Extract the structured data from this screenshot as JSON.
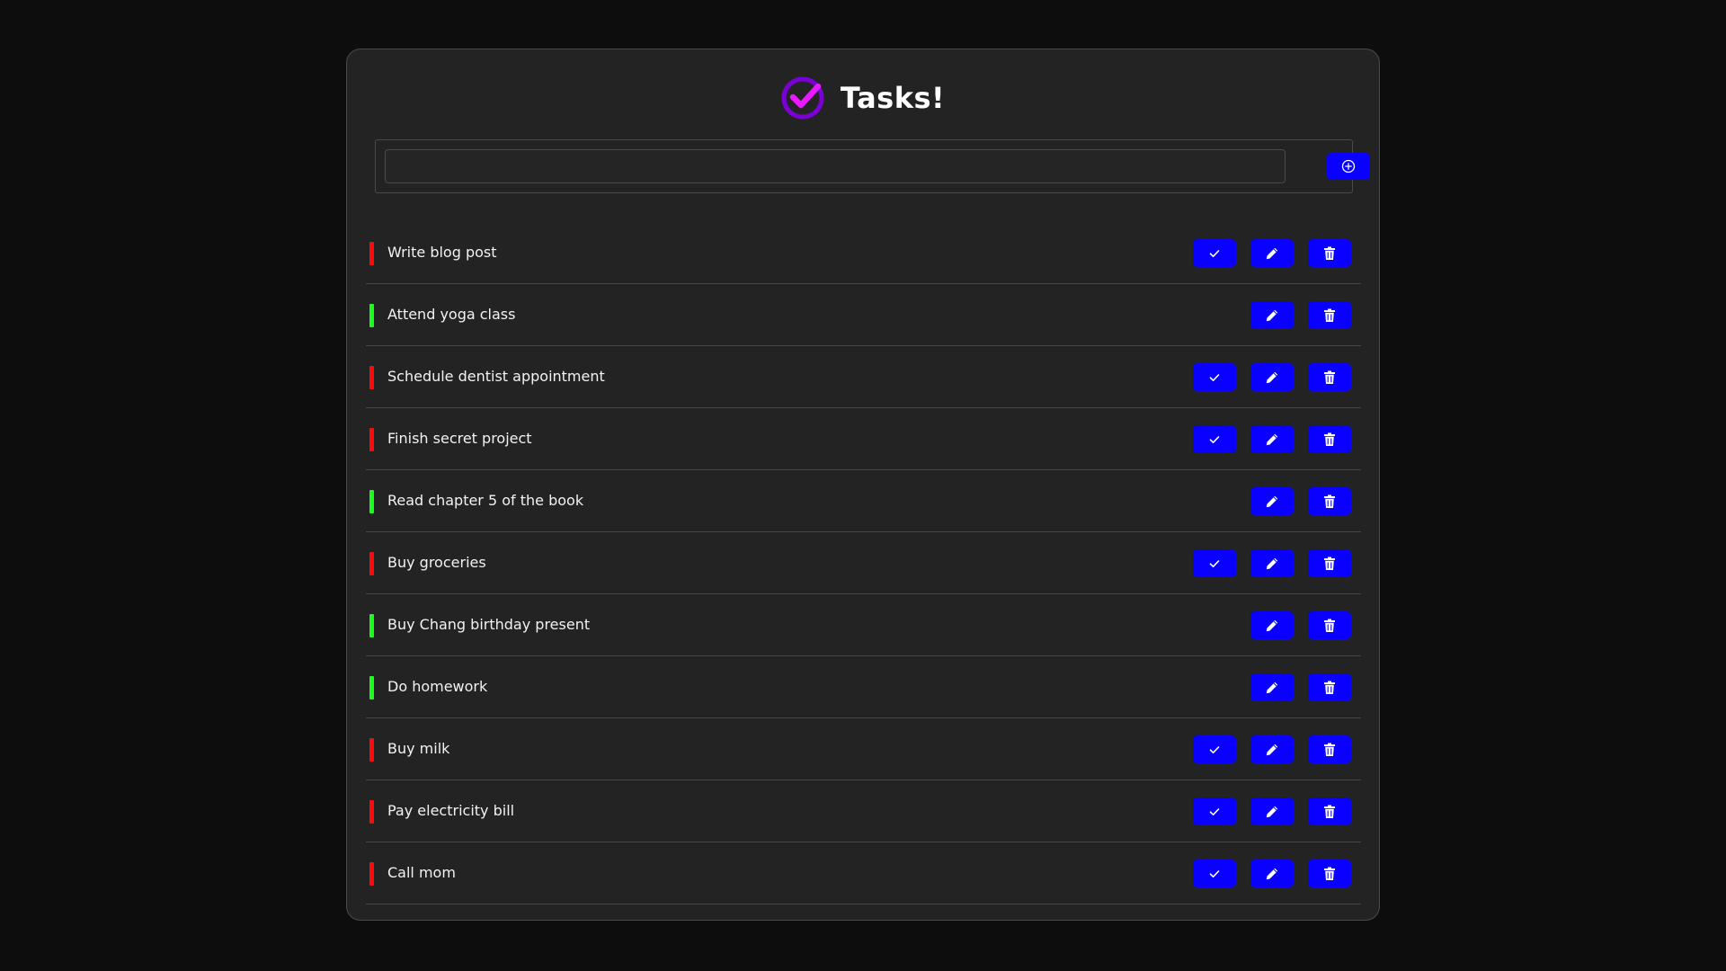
{
  "app": {
    "title": "Tasks!",
    "logo_icon": "check-circle-icon"
  },
  "form": {
    "input_value": "",
    "placeholder": "",
    "add_icon": "plus-circle-icon"
  },
  "colors": {
    "background": "#0d0d0e",
    "card": "#232324",
    "accent": "#0a00ff",
    "priority_high": "#ff0a0a",
    "priority_low": "#1aff1a",
    "logo_primary": "#7a00d6",
    "logo_check": "#e81aff"
  },
  "tasks": [
    {
      "text": "Write blog post",
      "priority": "high",
      "completed": false
    },
    {
      "text": "Attend yoga class",
      "priority": "low",
      "completed": true
    },
    {
      "text": "Schedule dentist appointment",
      "priority": "high",
      "completed": false
    },
    {
      "text": "Finish secret project",
      "priority": "high",
      "completed": false
    },
    {
      "text": "Read chapter 5 of the book",
      "priority": "low",
      "completed": true
    },
    {
      "text": "Buy groceries",
      "priority": "high",
      "completed": false
    },
    {
      "text": "Buy Chang birthday present",
      "priority": "low",
      "completed": true
    },
    {
      "text": "Do homework",
      "priority": "low",
      "completed": true
    },
    {
      "text": "Buy milk",
      "priority": "high",
      "completed": false
    },
    {
      "text": "Pay electricity bill",
      "priority": "high",
      "completed": false
    },
    {
      "text": "Call mom",
      "priority": "high",
      "completed": false
    },
    {
      "text": "",
      "priority": "none",
      "completed": true
    }
  ],
  "icons": {
    "complete": "check-icon",
    "edit": "pencil-icon",
    "delete": "trash-icon"
  }
}
